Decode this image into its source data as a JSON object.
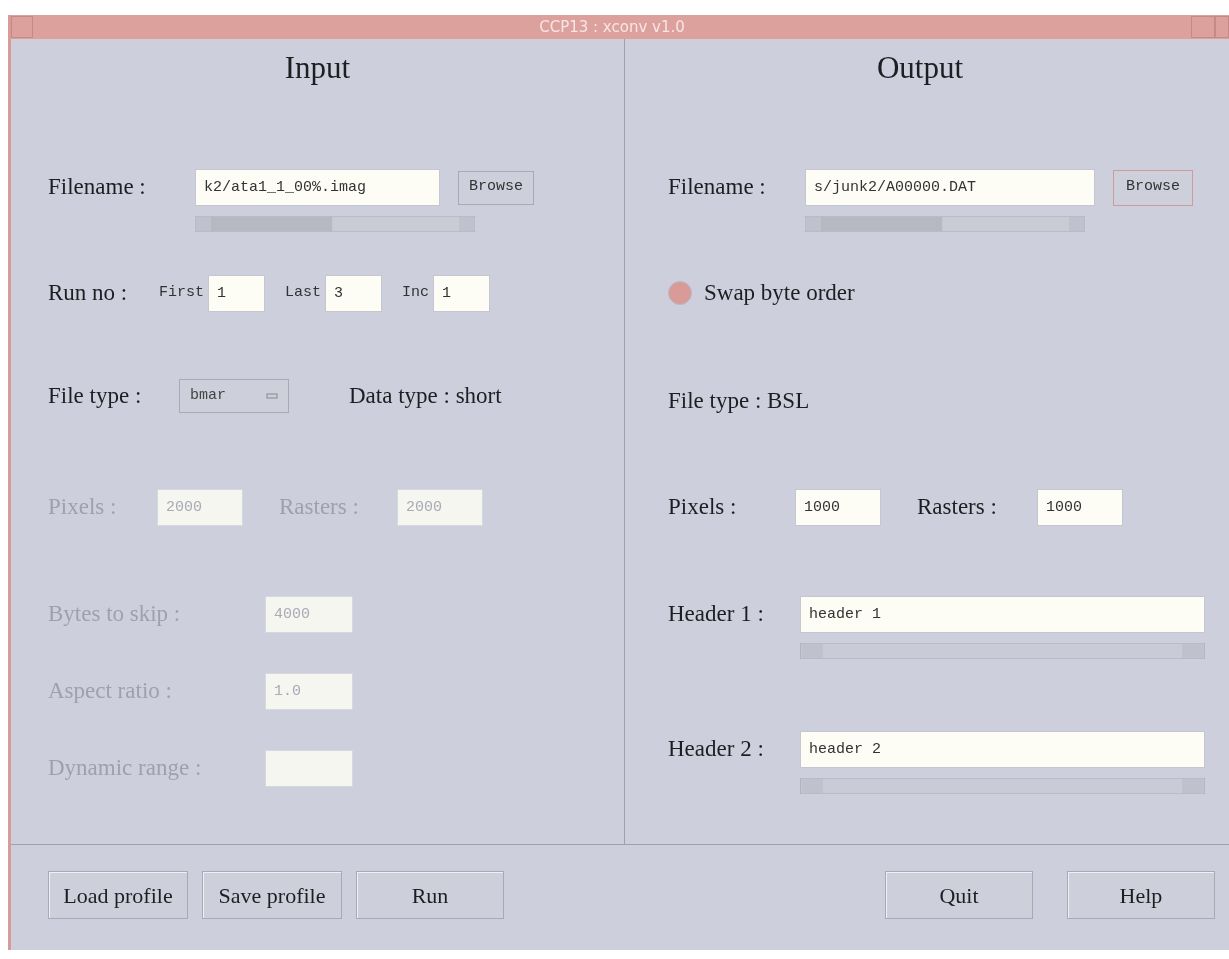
{
  "window": {
    "title": "CCP13 : xconv v1.0"
  },
  "input": {
    "heading": "Input",
    "filename": {
      "label": "Filename :",
      "value": "k2/ata1_1_00%.imag",
      "button": "Browse"
    },
    "run_no": {
      "label": "Run no :",
      "fields": [
        {
          "label": "First",
          "value": "1"
        },
        {
          "label": "Last",
          "value": "3"
        },
        {
          "label": "Inc",
          "value": "1"
        }
      ]
    },
    "file_type": {
      "label": "File type :",
      "value": "bmar"
    },
    "data_type": "Data type : short",
    "pixels": {
      "label": "Pixels :",
      "value": "2000",
      "disabled": true
    },
    "rasters": {
      "label": "Rasters :",
      "value": "2000",
      "disabled": true
    },
    "settings": [
      {
        "label": "Bytes to skip :",
        "value": "4000",
        "disabled": true
      },
      {
        "label": "Aspect ratio :",
        "value": "1.0",
        "disabled": true
      },
      {
        "label": "Dynamic range :",
        "disabled": true
      }
    ]
  },
  "output": {
    "heading": "Output",
    "filename": {
      "label": "Filename :",
      "value": "s/junk2/A00000.DAT",
      "button": "Browse"
    },
    "swap": {
      "label": "Swap byte order",
      "on": true
    },
    "file_type": "File type : BSL",
    "pixels": {
      "label": "Pixels :",
      "value": "1000",
      "disabled": false
    },
    "rasters": {
      "label": "Rasters :",
      "value": "1000",
      "disabled": false
    },
    "headers": [
      {
        "label": "Header 1 :",
        "value": "header 1"
      },
      {
        "label": "Header 2 :",
        "value": "header 2"
      }
    ]
  },
  "buttons_left": [
    "Load profile",
    "Save profile",
    "Run"
  ],
  "buttons_right": [
    "Quit",
    "Help"
  ]
}
